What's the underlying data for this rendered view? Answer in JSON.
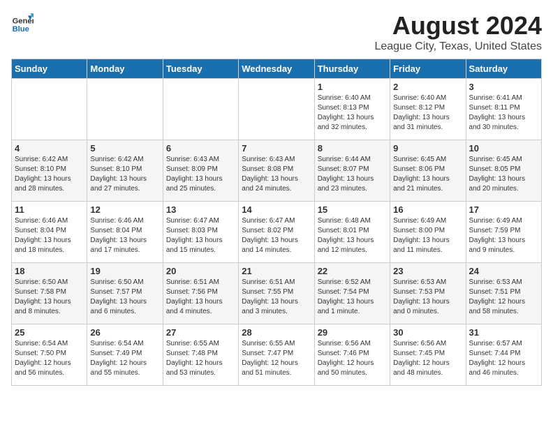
{
  "header": {
    "logo_general": "General",
    "logo_blue": "Blue",
    "title": "August 2024",
    "subtitle": "League City, Texas, United States"
  },
  "days_of_week": [
    "Sunday",
    "Monday",
    "Tuesday",
    "Wednesday",
    "Thursday",
    "Friday",
    "Saturday"
  ],
  "weeks": [
    [
      {
        "day": "",
        "content": ""
      },
      {
        "day": "",
        "content": ""
      },
      {
        "day": "",
        "content": ""
      },
      {
        "day": "",
        "content": ""
      },
      {
        "day": "1",
        "content": "Sunrise: 6:40 AM\nSunset: 8:13 PM\nDaylight: 13 hours and 32 minutes."
      },
      {
        "day": "2",
        "content": "Sunrise: 6:40 AM\nSunset: 8:12 PM\nDaylight: 13 hours and 31 minutes."
      },
      {
        "day": "3",
        "content": "Sunrise: 6:41 AM\nSunset: 8:11 PM\nDaylight: 13 hours and 30 minutes."
      }
    ],
    [
      {
        "day": "4",
        "content": "Sunrise: 6:42 AM\nSunset: 8:10 PM\nDaylight: 13 hours and 28 minutes."
      },
      {
        "day": "5",
        "content": "Sunrise: 6:42 AM\nSunset: 8:10 PM\nDaylight: 13 hours and 27 minutes."
      },
      {
        "day": "6",
        "content": "Sunrise: 6:43 AM\nSunset: 8:09 PM\nDaylight: 13 hours and 25 minutes."
      },
      {
        "day": "7",
        "content": "Sunrise: 6:43 AM\nSunset: 8:08 PM\nDaylight: 13 hours and 24 minutes."
      },
      {
        "day": "8",
        "content": "Sunrise: 6:44 AM\nSunset: 8:07 PM\nDaylight: 13 hours and 23 minutes."
      },
      {
        "day": "9",
        "content": "Sunrise: 6:45 AM\nSunset: 8:06 PM\nDaylight: 13 hours and 21 minutes."
      },
      {
        "day": "10",
        "content": "Sunrise: 6:45 AM\nSunset: 8:05 PM\nDaylight: 13 hours and 20 minutes."
      }
    ],
    [
      {
        "day": "11",
        "content": "Sunrise: 6:46 AM\nSunset: 8:04 PM\nDaylight: 13 hours and 18 minutes."
      },
      {
        "day": "12",
        "content": "Sunrise: 6:46 AM\nSunset: 8:04 PM\nDaylight: 13 hours and 17 minutes."
      },
      {
        "day": "13",
        "content": "Sunrise: 6:47 AM\nSunset: 8:03 PM\nDaylight: 13 hours and 15 minutes."
      },
      {
        "day": "14",
        "content": "Sunrise: 6:47 AM\nSunset: 8:02 PM\nDaylight: 13 hours and 14 minutes."
      },
      {
        "day": "15",
        "content": "Sunrise: 6:48 AM\nSunset: 8:01 PM\nDaylight: 13 hours and 12 minutes."
      },
      {
        "day": "16",
        "content": "Sunrise: 6:49 AM\nSunset: 8:00 PM\nDaylight: 13 hours and 11 minutes."
      },
      {
        "day": "17",
        "content": "Sunrise: 6:49 AM\nSunset: 7:59 PM\nDaylight: 13 hours and 9 minutes."
      }
    ],
    [
      {
        "day": "18",
        "content": "Sunrise: 6:50 AM\nSunset: 7:58 PM\nDaylight: 13 hours and 8 minutes."
      },
      {
        "day": "19",
        "content": "Sunrise: 6:50 AM\nSunset: 7:57 PM\nDaylight: 13 hours and 6 minutes."
      },
      {
        "day": "20",
        "content": "Sunrise: 6:51 AM\nSunset: 7:56 PM\nDaylight: 13 hours and 4 minutes."
      },
      {
        "day": "21",
        "content": "Sunrise: 6:51 AM\nSunset: 7:55 PM\nDaylight: 13 hours and 3 minutes."
      },
      {
        "day": "22",
        "content": "Sunrise: 6:52 AM\nSunset: 7:54 PM\nDaylight: 13 hours and 1 minute."
      },
      {
        "day": "23",
        "content": "Sunrise: 6:53 AM\nSunset: 7:53 PM\nDaylight: 13 hours and 0 minutes."
      },
      {
        "day": "24",
        "content": "Sunrise: 6:53 AM\nSunset: 7:51 PM\nDaylight: 12 hours and 58 minutes."
      }
    ],
    [
      {
        "day": "25",
        "content": "Sunrise: 6:54 AM\nSunset: 7:50 PM\nDaylight: 12 hours and 56 minutes."
      },
      {
        "day": "26",
        "content": "Sunrise: 6:54 AM\nSunset: 7:49 PM\nDaylight: 12 hours and 55 minutes."
      },
      {
        "day": "27",
        "content": "Sunrise: 6:55 AM\nSunset: 7:48 PM\nDaylight: 12 hours and 53 minutes."
      },
      {
        "day": "28",
        "content": "Sunrise: 6:55 AM\nSunset: 7:47 PM\nDaylight: 12 hours and 51 minutes."
      },
      {
        "day": "29",
        "content": "Sunrise: 6:56 AM\nSunset: 7:46 PM\nDaylight: 12 hours and 50 minutes."
      },
      {
        "day": "30",
        "content": "Sunrise: 6:56 AM\nSunset: 7:45 PM\nDaylight: 12 hours and 48 minutes."
      },
      {
        "day": "31",
        "content": "Sunrise: 6:57 AM\nSunset: 7:44 PM\nDaylight: 12 hours and 46 minutes."
      }
    ]
  ]
}
